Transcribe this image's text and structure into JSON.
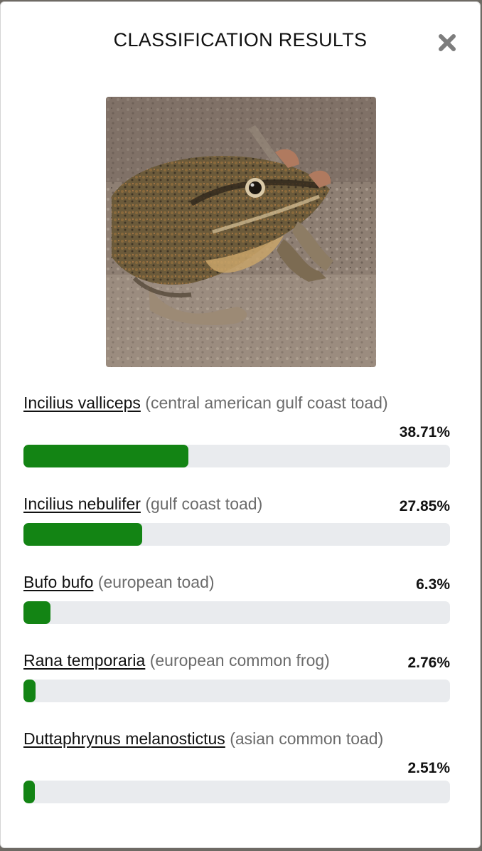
{
  "dialog": {
    "title": "CLASSIFICATION RESULTS",
    "close_icon": "close-icon"
  },
  "image": {
    "subject_icon": "toad-photo"
  },
  "colors": {
    "bar_fill": "#138414",
    "bar_track": "#e9ebee",
    "common_name_text": "#6b6b6b"
  },
  "results": [
    {
      "scientific": "Incilius valliceps",
      "common": "(central american gulf coast toad)",
      "percent_label": "38.71%",
      "value": 38.71
    },
    {
      "scientific": "Incilius nebulifer",
      "common": "(gulf coast toad)",
      "percent_label": "27.85%",
      "value": 27.85
    },
    {
      "scientific": "Bufo bufo",
      "common": "(european toad)",
      "percent_label": "6.3%",
      "value": 6.3
    },
    {
      "scientific": "Rana temporaria",
      "common": "(european common frog)",
      "percent_label": "2.76%",
      "value": 2.76
    },
    {
      "scientific": "Duttaphrynus melanostictus",
      "common": "(asian common toad)",
      "percent_label": "2.51%",
      "value": 2.51
    }
  ]
}
